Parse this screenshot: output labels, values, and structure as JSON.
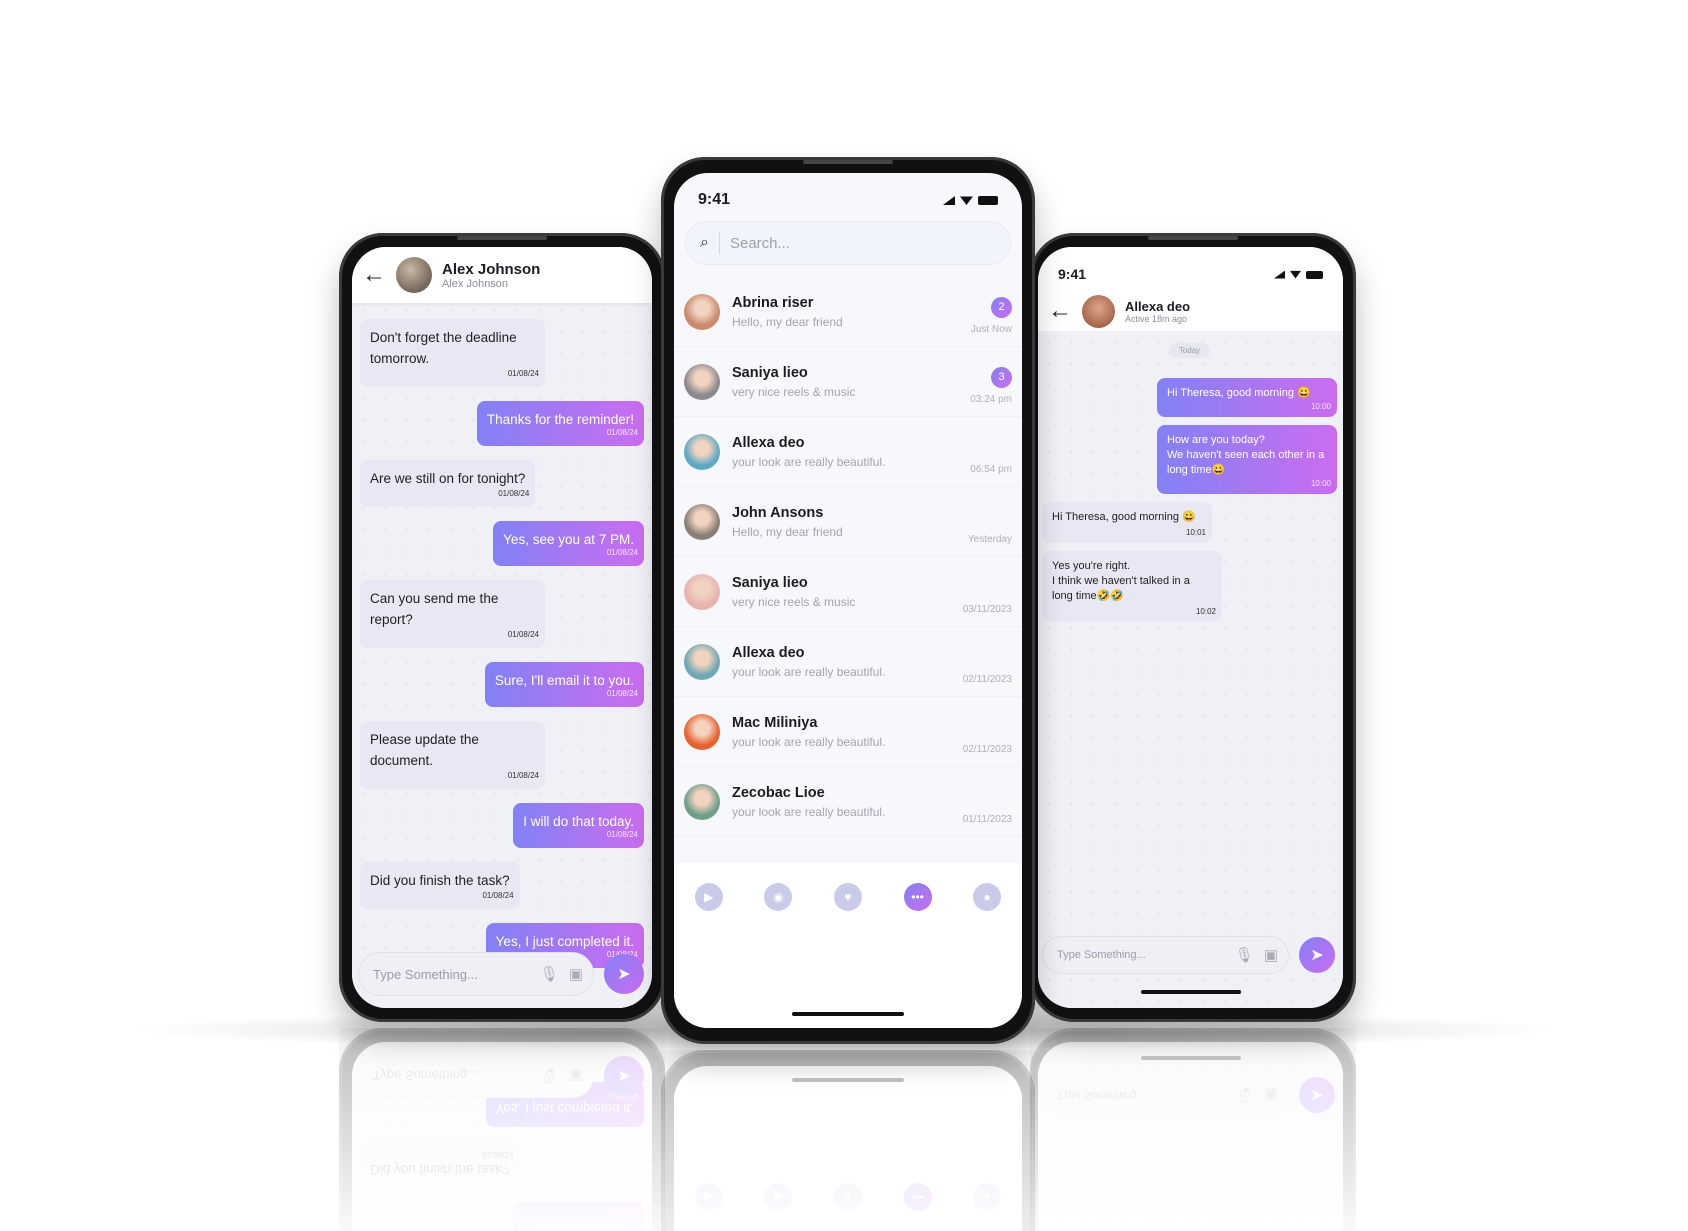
{
  "colors": {
    "accent_start": "#8281f6",
    "accent_end": "#cb6cf0",
    "incoming_bubble": "#e7e8f3",
    "chat_background": "#f0f1f7"
  },
  "left_chat": {
    "contact_name": "Alex Johnson",
    "contact_subtitle": "Alex Johnson",
    "messages": [
      {
        "dir": "in",
        "text": "Don't forget the deadline tomorrow.",
        "time": "01/08/24"
      },
      {
        "dir": "out",
        "text": "Thanks for the reminder!",
        "time": "01/08/24"
      },
      {
        "dir": "in",
        "text": "Are we still on for tonight?",
        "time": "01/08/24"
      },
      {
        "dir": "out",
        "text": "Yes, see you at 7 PM.",
        "time": "01/08/24"
      },
      {
        "dir": "in",
        "text": "Can you send me the report?",
        "time": "01/08/24"
      },
      {
        "dir": "out",
        "text": "Sure, I'll email it to you.",
        "time": "01/08/24"
      },
      {
        "dir": "in",
        "text": "Please update the document.",
        "time": "01/08/24"
      },
      {
        "dir": "out",
        "text": "I will do that today.",
        "time": "01/08/24"
      },
      {
        "dir": "in",
        "text": "Did you finish the task?",
        "time": "01/08/24"
      },
      {
        "dir": "out",
        "text": "Yes, I just completed it.",
        "time": "01/08/24"
      }
    ],
    "input_placeholder": "Type Something...",
    "icons": [
      "back-arrow-icon",
      "microphone-icon",
      "image-icon",
      "send-icon"
    ]
  },
  "chat_list": {
    "status_time": "9:41",
    "search_placeholder": "Search...",
    "conversations": [
      {
        "name": "Abrina riser",
        "preview": "Hello, my dear friend",
        "time": "Just Now",
        "unread": "2",
        "avatar": "#c98a6d"
      },
      {
        "name": "Saniya lieo",
        "preview": "very nice reels & music",
        "time": "03:24 pm",
        "unread": "3",
        "avatar": "#8d8a8f"
      },
      {
        "name": "Allexa deo",
        "preview": "your look are really beautiful.",
        "time": "06:54 pm",
        "unread": "",
        "avatar": "#5ea9c4"
      },
      {
        "name": "John Ansons",
        "preview": "Hello, my dear friend",
        "time": "Yesterday",
        "unread": "",
        "avatar": "#8a7f76"
      },
      {
        "name": "Saniya lieo",
        "preview": "very nice reels & music",
        "time": "03/11/2023",
        "unread": "",
        "avatar": "#e7b3b0"
      },
      {
        "name": "Allexa deo",
        "preview": "your look are really beautiful.",
        "time": "02/11/2023",
        "unread": "",
        "avatar": "#6fa7b3"
      },
      {
        "name": "Mac Miliniya",
        "preview": "your look are really beautiful.",
        "time": "02/11/2023",
        "unread": "",
        "avatar": "#e8622f"
      },
      {
        "name": "Zecobac Lioe",
        "preview": "your look are really beautiful.",
        "time": "01/11/2023",
        "unread": "",
        "avatar": "#6f9f8a"
      }
    ],
    "nav": [
      {
        "icon": "reels-icon",
        "active": false
      },
      {
        "icon": "live-tv-icon",
        "active": false
      },
      {
        "icon": "dating-flame-icon",
        "active": false
      },
      {
        "icon": "chats-icon",
        "active": true
      },
      {
        "icon": "profile-icon",
        "active": false
      }
    ]
  },
  "right_chat": {
    "status_time": "9:41",
    "contact_name": "Allexa deo",
    "contact_subtitle": "Active 18m ago",
    "date_divider": "Today",
    "messages": [
      {
        "dir": "out",
        "text": "Hi Theresa, good morning 😀",
        "time": "10:00"
      },
      {
        "dir": "out",
        "text": "How are you today?\nWe haven't seen each other in a long time😀",
        "time": "10:00"
      },
      {
        "dir": "in",
        "text": "Hi Theresa, good morning 😀",
        "time": "10:01"
      },
      {
        "dir": "in",
        "text": "Yes you're right.\nI think we haven't talked in a long time🤣🤣",
        "time": "10:02"
      }
    ],
    "input_placeholder": "Type Something..."
  }
}
